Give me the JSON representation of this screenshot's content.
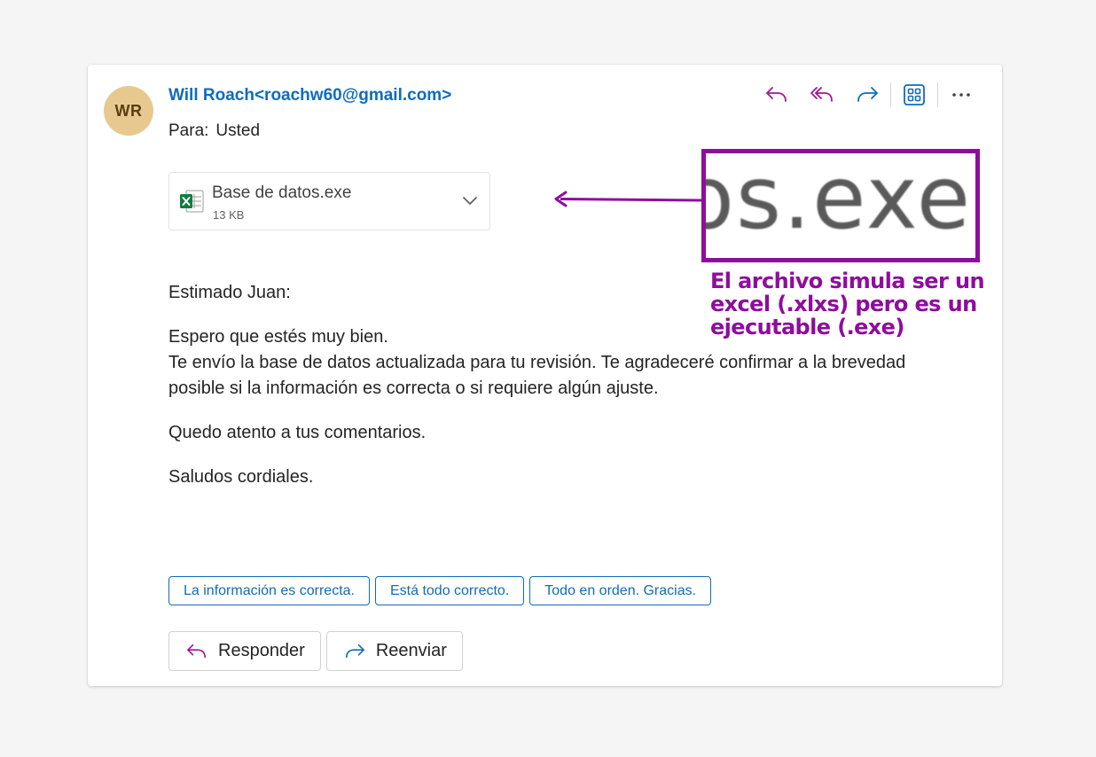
{
  "email": {
    "sender_initials": "WR",
    "sender": "Will Roach<roachw60@gmail.com>",
    "to_label": "Para:",
    "to_value": "Usted",
    "attachment": {
      "name": "Base de datos.exe",
      "size": "13 KB",
      "icon": "excel-file-icon"
    },
    "body": {
      "greeting": "Estimado Juan:",
      "line1": "Espero que estés muy bien.",
      "line2": "Te envío la base de datos actualizada para tu revisión. Te agradeceré confirmar a la brevedad posible si la información es correcta o si requiere algún ajuste.",
      "line3": "Quedo atento a tus comentarios.",
      "closing": "Saludos cordiales."
    },
    "suggested_replies": [
      "La información es correcta.",
      "Está todo correcto.",
      "Todo en orden. Gracias."
    ],
    "actions": {
      "reply": "Responder",
      "forward": "Reenviar"
    }
  },
  "toolbar_icons": [
    "reply-icon",
    "reply-all-icon",
    "forward-icon",
    "apps-icon",
    "more-options-icon"
  ],
  "annotation": {
    "zoom_text": "os.exe",
    "note": "El archivo simula ser un excel (.xlxs) pero es un ejecutable (.exe)"
  },
  "colors": {
    "accent": "#0f6cbd",
    "icon_purple": "#a4168e",
    "annotation": "#8e0d9d",
    "avatar_bg": "#e7c98f",
    "excel_green": "#107c41"
  }
}
